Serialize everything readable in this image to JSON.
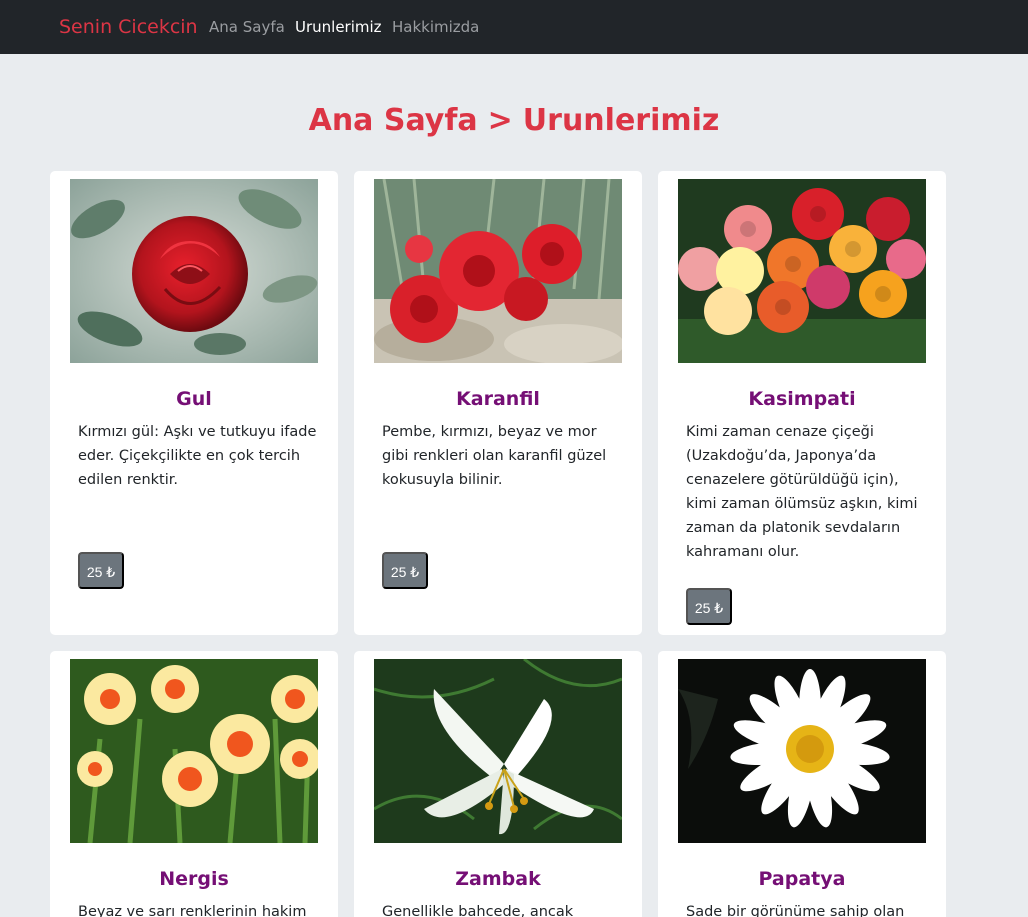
{
  "navbar": {
    "brand": "Senin Cicekcin",
    "links": [
      {
        "label": "Ana Sayfa",
        "active": false
      },
      {
        "label": "Urunlerimiz",
        "active": true
      },
      {
        "label": "Hakkimizda",
        "active": false
      }
    ]
  },
  "breadcrumb": {
    "home": "Ana Sayfa",
    "separator": ">",
    "current": "Urunlerimiz"
  },
  "colors": {
    "accent": "#dc3545",
    "navbar_bg": "#212529",
    "page_bg": "#e9ecef",
    "card_title": "#750f75",
    "price_badge": "#6c757d"
  },
  "products": [
    {
      "name": "Gul",
      "description": "Kırmızı gül: Aşkı ve tutkuyu ifade eder. Çiçekçilikte en çok tercih edilen renktir.",
      "price": "25 ₺",
      "image": "red-rose-photo"
    },
    {
      "name": "Karanfil",
      "description": "Pembe, kırmızı, beyaz ve mor gibi renkleri olan karanfil güzel kokusuyla bilinir.",
      "price": "25 ₺",
      "image": "red-carnation-photo"
    },
    {
      "name": "Kasimpati",
      "description": "Kimi zaman cenaze çiçeği (Uzakdoğu’da, Japonya’da cenazelere götürüldüğü için), kimi zaman ölümsüz aşkın, kimi zaman da platonik sevdaların kahramanı olur.",
      "price": "25 ₺",
      "image": "chrysanthemum-photo"
    },
    {
      "name": "Nergis",
      "description": "Beyaz ve sarı renklerinin hakim",
      "image": "daffodil-photo"
    },
    {
      "name": "Zambak",
      "description": "Genellikle bahcede, ancak",
      "image": "white-lily-photo"
    },
    {
      "name": "Papatya",
      "description": "Sade bir görünüme sahip olan",
      "image": "daisy-photo"
    }
  ]
}
